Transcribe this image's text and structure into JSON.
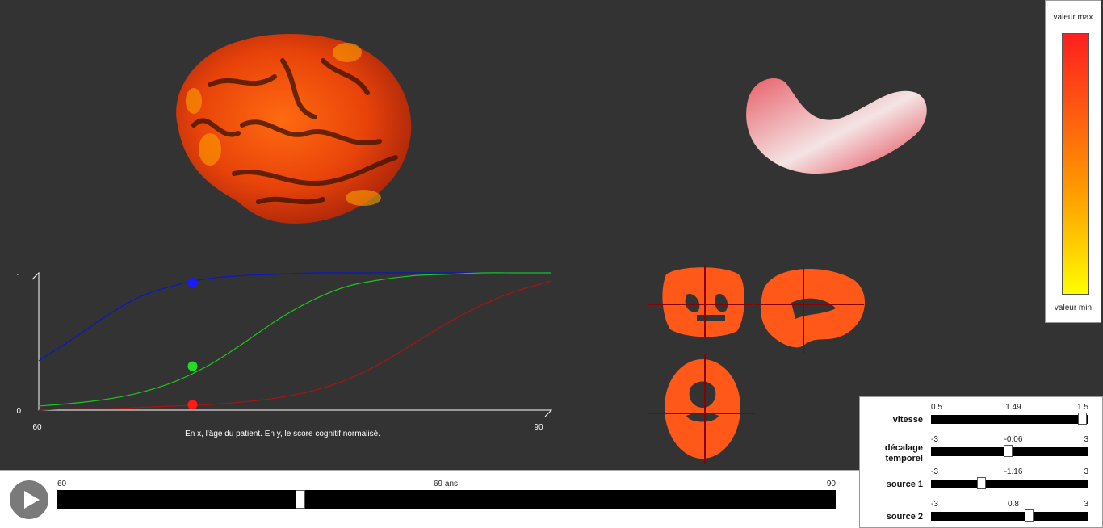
{
  "legend": {
    "max_label": "valeur max",
    "min_label": "valeur min",
    "colors": [
      "#ff1f1f",
      "#ff9a00",
      "#ffff00"
    ]
  },
  "chart": {
    "caption": "En x, l'âge du patient. En y, le score cognitif normalisé.",
    "x_min_label": "60",
    "x_max_label": "90",
    "y_min_label": "0",
    "y_max_label": "1"
  },
  "chart_data": {
    "type": "line",
    "title": "",
    "xlim": [
      60,
      90
    ],
    "ylim": [
      0,
      1
    ],
    "x": [
      60,
      62,
      64,
      66,
      68,
      70,
      72,
      74,
      76,
      78,
      80,
      82,
      84,
      86,
      88,
      90
    ],
    "series": [
      {
        "color": "#0a16c8",
        "values": [
          0.36,
          0.52,
          0.69,
          0.83,
          0.91,
          0.96,
          0.98,
          0.99,
          1.0,
          1.0,
          1.0,
          1.0,
          1.0,
          1.0,
          1.0,
          1.0
        ]
      },
      {
        "color": "#19c819",
        "values": [
          0.03,
          0.05,
          0.08,
          0.13,
          0.21,
          0.33,
          0.49,
          0.66,
          0.8,
          0.9,
          0.95,
          0.98,
          0.99,
          1.0,
          1.0,
          1.0
        ]
      },
      {
        "color": "#a81414",
        "values": [
          0.0,
          0.01,
          0.01,
          0.02,
          0.03,
          0.04,
          0.06,
          0.09,
          0.14,
          0.22,
          0.34,
          0.49,
          0.64,
          0.77,
          0.87,
          0.94
        ]
      }
    ],
    "markers": [
      {
        "color": "#1a1aff",
        "x": 69,
        "y": 0.93
      },
      {
        "color": "#22dd22",
        "x": 69,
        "y": 0.32
      },
      {
        "color": "#ff1a1a",
        "x": 69,
        "y": 0.04
      }
    ]
  },
  "controls": [
    {
      "name": "vitesse",
      "label": "vitesse",
      "min": "0.5",
      "value": "1.49",
      "max": "1.5",
      "fraction": 0.99
    },
    {
      "name": "decalage-temporel",
      "label": "décalage temporel",
      "min": "-3",
      "value": "-0.06",
      "max": "3",
      "fraction": 0.49
    },
    {
      "name": "source-1",
      "label": "source 1",
      "min": "-3",
      "value": "-1.16",
      "max": "3",
      "fraction": 0.31
    },
    {
      "name": "source-2",
      "label": "source 2",
      "min": "-3",
      "value": "0.8",
      "max": "3",
      "fraction": 0.63
    }
  ],
  "timeline": {
    "min": "60",
    "value": "69 ans",
    "max": "90",
    "fraction": 0.31
  },
  "icons": {
    "play": "play-icon"
  }
}
